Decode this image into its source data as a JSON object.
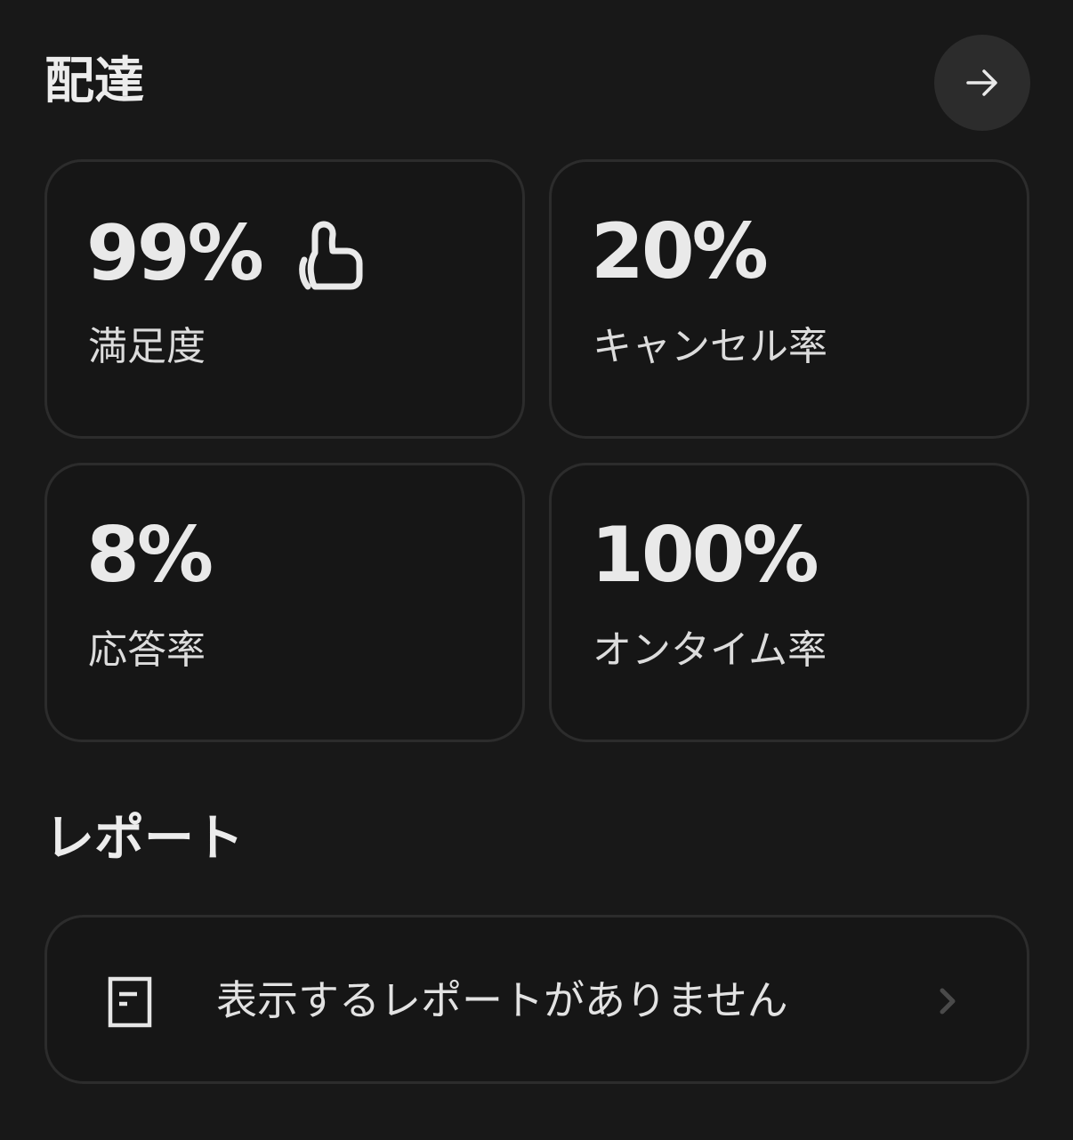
{
  "delivery": {
    "title": "配達",
    "open_icon": "arrow-right-icon",
    "stats": [
      {
        "value": "99%",
        "label": "満足度",
        "icon": "thumbs-up-icon"
      },
      {
        "value": "20%",
        "label": "キャンセル率"
      },
      {
        "value": "8%",
        "label": "応答率"
      },
      {
        "value": "100%",
        "label": "オンタイム率"
      }
    ]
  },
  "reports": {
    "title": "レポート",
    "empty_message": "表示するレポートがありません",
    "item_icon": "document-icon",
    "chevron_icon": "chevron-right-icon"
  },
  "colors": {
    "background": "#181818",
    "card_border": "#2c2c2c",
    "button_bg": "#2c2c2c",
    "text": "#e6e6e6"
  }
}
